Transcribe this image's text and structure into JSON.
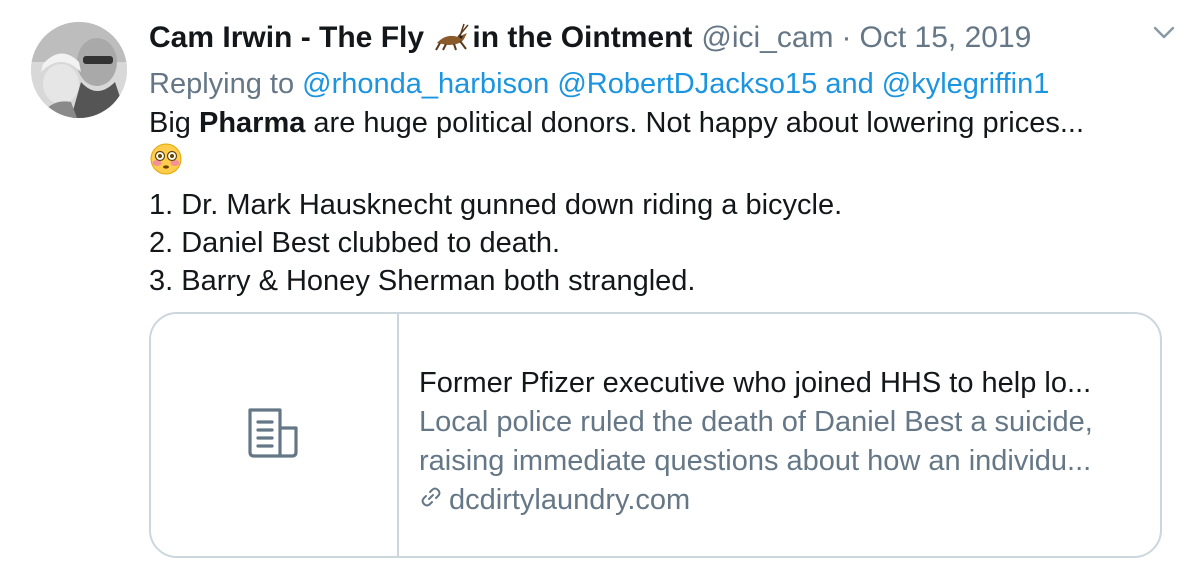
{
  "tweet": {
    "display_name": "Cam Irwin - The Fly",
    "display_name_suffix": "in the Ointment",
    "handle": "@ici_cam",
    "separator": "·",
    "date": "Oct 15, 2019",
    "replying_to_label": "Replying to",
    "mention_1": "@rhonda_harbison",
    "mention_2": "@RobertDJackso15",
    "and_label": "and",
    "mention_3": "@kylegriffin1",
    "body_prefix": "Big ",
    "body_bold": "Pharma",
    "body_suffix": " are huge political donors. Not happy about lowering prices...",
    "body_lines": [
      "1. Dr. Mark Hausknecht gunned down riding a bicycle.",
      "2. Daniel Best clubbed to death.",
      "3. Barry & Honey Sherman both strangled."
    ]
  },
  "card": {
    "title": "Former Pfizer executive who joined HHS to help lo...",
    "description_line_1": "Local police ruled the death of Daniel Best a suicide,",
    "description_line_2": "raising immediate questions about how an individu...",
    "domain": "dcdirtylaundry.com"
  },
  "icons": {
    "name_emoji": "cricket-icon",
    "body_emoji": "flushed-face-icon",
    "card_media": "document-icon",
    "link": "link-icon",
    "menu": "chevron-down-icon"
  },
  "colors": {
    "text": "#14171a",
    "secondary": "#657786",
    "link": "#1b95e0",
    "border": "#ccd6dd"
  }
}
